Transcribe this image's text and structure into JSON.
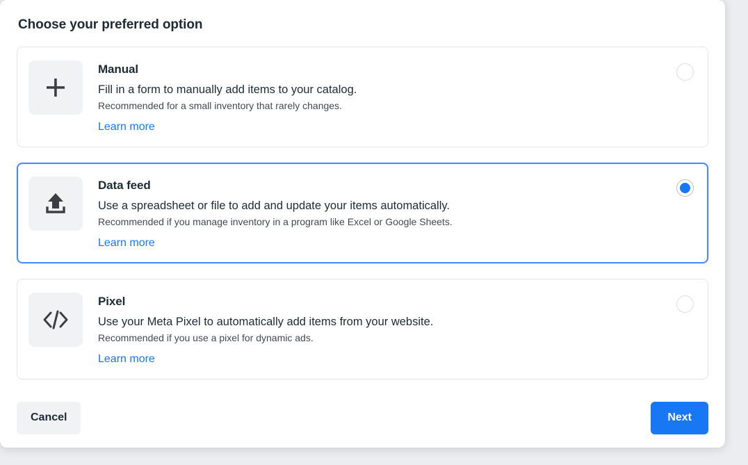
{
  "dialog": {
    "title": "Choose your preferred option",
    "accent_color": "#1877f2",
    "selected_border_color": "#4a8bf5",
    "tile_bg_color": "#f1f2f4"
  },
  "options": [
    {
      "id": "manual",
      "icon": "plus-icon",
      "title": "Manual",
      "description": "Fill in a form to manually add items to your catalog.",
      "recommendation": "Recommended for a small inventory that rarely changes.",
      "learn_more": "Learn more",
      "selected": false
    },
    {
      "id": "data-feed",
      "icon": "upload-icon",
      "title": "Data feed",
      "description": "Use a spreadsheet or file to add and update your items automatically.",
      "recommendation": "Recommended if you manage inventory in a program like Excel or Google Sheets.",
      "learn_more": "Learn more",
      "selected": true
    },
    {
      "id": "pixel",
      "icon": "code-icon",
      "title": "Pixel",
      "description": "Use your Meta Pixel to automatically add items from your website.",
      "recommendation": "Recommended if you use a pixel for dynamic ads.",
      "learn_more": "Learn more",
      "selected": false
    }
  ],
  "footer": {
    "cancel_label": "Cancel",
    "next_label": "Next"
  }
}
